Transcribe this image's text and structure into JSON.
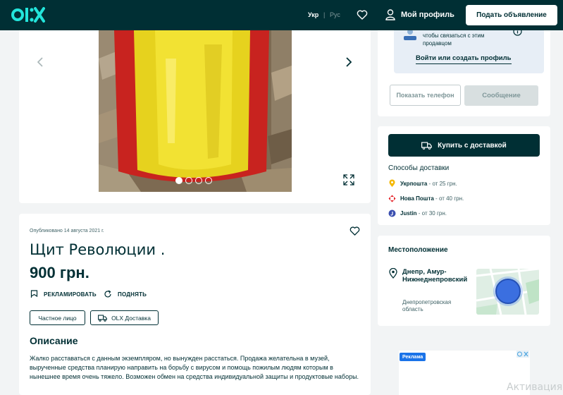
{
  "header": {
    "lang_ukr": "Укр",
    "lang_sep": "|",
    "lang_rus": "Рус",
    "profile_label": "Мой профиль",
    "post_ad_label": "Подать объявление"
  },
  "gallery": {
    "slide_count": 4,
    "active_slide": 1
  },
  "listing": {
    "published": "Опубликовано 14 августа 2021 г.",
    "title": "Щит Революции .",
    "price": "900 грн.",
    "promote_label": "РЕКЛАМИРОВАТЬ",
    "raise_label": "ПОДНЯТЬ",
    "tag_private": "Частное лицо",
    "tag_delivery": "OLX Доставка",
    "description_heading": "Описание",
    "description": "Жалко расставаться с данным экземпляром, но вынужден расстаться. Продажа желательна в музей, вырученные средства планирую направить на борьбу с вирусом и помощь пожилым людям которым в нынешнее время очень тяжело. Возможен обмен на средства индивидуальной защиты и продуктовые наборы."
  },
  "contact": {
    "login_text": "чтобы связаться с этим продавцом",
    "login_link": "Войти или создать профиль",
    "phone_label": "Показать телефон",
    "message_label": "Сообщение"
  },
  "delivery": {
    "buy_label": "Купить с доставкой",
    "heading": "Способы доставки",
    "carriers": [
      {
        "name": "Укрпошта",
        "price": " - от 25 грн.",
        "color": "#f5b800"
      },
      {
        "name": "Нова Пошта",
        "price": " - от 40 грн.",
        "color": "#e42127"
      },
      {
        "name": "Justin",
        "price": " - от 30 грн.",
        "color": "#3b4fb0"
      }
    ]
  },
  "location": {
    "heading": "Местоположение",
    "city": "Днепр, Амур-Нижнеднепровский",
    "region": "Днепропетровская область"
  },
  "ad": {
    "badge": "Реклама"
  },
  "watermark": "Активация",
  "colors": {
    "brand_dark": "#002f34",
    "login_box": "#e7eef6",
    "page_bg": "#f2f4f5"
  }
}
